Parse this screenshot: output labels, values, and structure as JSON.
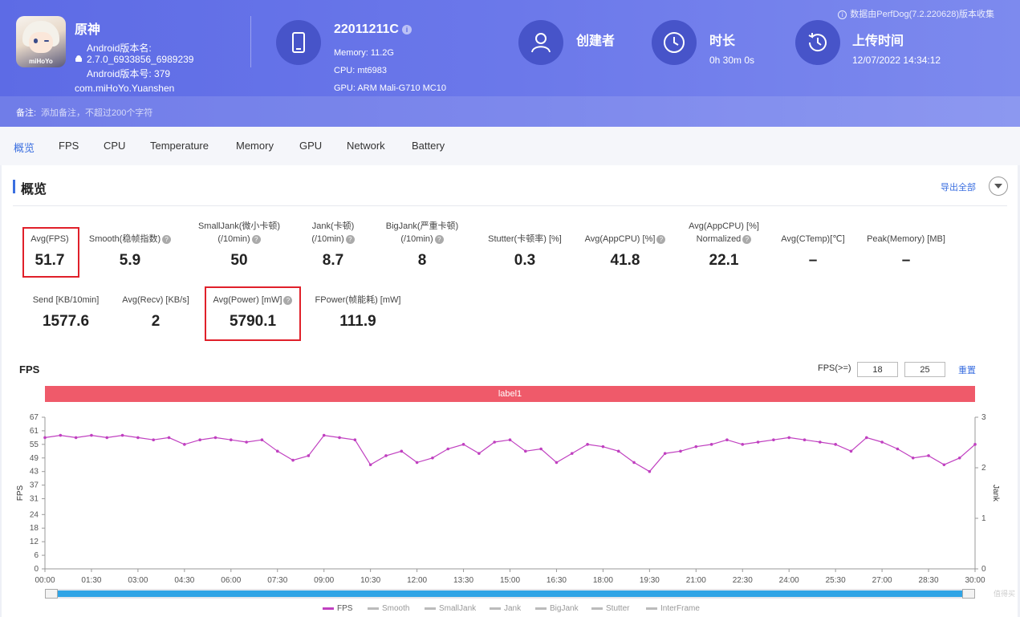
{
  "app": {
    "name": "原神",
    "icon_text": "miHoYo",
    "android_name_label": "Android版本名:",
    "android_name_value": "2.7.0_6933856_6989239",
    "android_code": "Android版本号: 379",
    "package": "com.miHoYo.Yuanshen"
  },
  "device": {
    "id": "22011211C",
    "memory": "Memory: 11.2G",
    "cpu": "CPU: mt6983",
    "gpu": "GPU: ARM Mali-G710 MC10"
  },
  "creator": {
    "title": "创建者"
  },
  "duration": {
    "title": "时长",
    "value": "0h 30m 0s"
  },
  "upload": {
    "title": "上传时间",
    "value": "12/07/2022 14:34:12"
  },
  "collected_by": "数据由PerfDog(7.2.220628)版本收集",
  "note": {
    "label": "备注:",
    "placeholder": "添加备注，不超过200个字符"
  },
  "tabs": [
    "概览",
    "FPS",
    "CPU",
    "Temperature",
    "Memory",
    "GPU",
    "Network",
    "Battery"
  ],
  "section": {
    "title": "概览",
    "export": "导出全部"
  },
  "metrics_row1": [
    {
      "label1": "",
      "label2": "Avg(FPS)",
      "value": "51.7",
      "help": false
    },
    {
      "label1": "",
      "label2": "Smooth(稳帧指数)",
      "value": "5.9",
      "help": true
    },
    {
      "label1": "SmallJank(微小卡顿)",
      "label2": "(/10min)",
      "value": "50",
      "help": true
    },
    {
      "label1": "Jank(卡顿)",
      "label2": "(/10min)",
      "value": "8.7",
      "help": true
    },
    {
      "label1": "BigJank(严重卡顿)",
      "label2": "(/10min)",
      "value": "8",
      "help": true
    },
    {
      "label1": "",
      "label2": "Stutter(卡顿率) [%]",
      "value": "0.3",
      "help": false
    },
    {
      "label1": "",
      "label2": "Avg(AppCPU) [%]",
      "value": "41.8",
      "help": true
    },
    {
      "label1": "Avg(AppCPU) [%]",
      "label2": "Normalized",
      "value": "22.1",
      "help": true
    },
    {
      "label1": "",
      "label2": "Avg(CTemp)[℃]",
      "value": "–",
      "help": false
    },
    {
      "label1": "",
      "label2": "Peak(Memory) [MB]",
      "value": "–",
      "help": false
    }
  ],
  "metrics_row2": [
    {
      "label2": "Send [KB/10min]",
      "value": "1577.6",
      "help": false
    },
    {
      "label2": "Avg(Recv) [KB/s]",
      "value": "2",
      "help": false
    },
    {
      "label2": "Avg(Power) [mW]",
      "value": "5790.1",
      "help": true
    },
    {
      "label2": "FPower(帧能耗) [mW]",
      "value": "111.9",
      "help": false
    }
  ],
  "fps_chart": {
    "title": "FPS",
    "threshold_label": "FPS(>=)",
    "threshold_low": "18",
    "threshold_high": "25",
    "reset": "重置",
    "label_bar": "label1",
    "legend": [
      "FPS",
      "Smooth",
      "SmallJank",
      "Jank",
      "BigJank",
      "Stutter",
      "InterFrame"
    ],
    "legend_active": "FPS"
  },
  "chart_data": {
    "type": "line",
    "title": "FPS",
    "ylabel": "FPS",
    "y2label": "Jank",
    "ylim": [
      0,
      67
    ],
    "y2lim": [
      0,
      3
    ],
    "yticks": [
      0,
      6,
      12,
      18,
      24,
      31,
      37,
      43,
      49,
      55,
      61,
      67
    ],
    "y2ticks": [
      0,
      1,
      2,
      3
    ],
    "xlim_minutes": [
      0,
      30
    ],
    "xticks": [
      "00:00",
      "01:30",
      "03:00",
      "04:30",
      "06:00",
      "07:30",
      "09:00",
      "10:30",
      "12:00",
      "13:30",
      "15:00",
      "16:30",
      "18:00",
      "19:30",
      "21:00",
      "22:30",
      "24:00",
      "25:30",
      "27:00",
      "28:30",
      "30:00"
    ],
    "series": [
      {
        "name": "FPS",
        "color": "#c040c0",
        "x_minutes": [
          0,
          0.5,
          1,
          1.5,
          2,
          2.5,
          3,
          3.5,
          4,
          4.5,
          5,
          5.5,
          6,
          6.5,
          7,
          7.5,
          8,
          8.5,
          9,
          9.5,
          10,
          10.5,
          11,
          11.5,
          12,
          12.5,
          13,
          13.5,
          14,
          14.5,
          15,
          15.5,
          16,
          16.5,
          17,
          17.5,
          18,
          18.5,
          19,
          19.5,
          20,
          20.5,
          21,
          21.5,
          22,
          22.5,
          23,
          23.5,
          24,
          24.5,
          25,
          25.5,
          26,
          26.5,
          27,
          27.5,
          28,
          28.5,
          29,
          29.5,
          30
        ],
        "values": [
          58,
          59,
          58,
          59,
          58,
          59,
          58,
          57,
          58,
          55,
          57,
          58,
          57,
          56,
          57,
          52,
          48,
          50,
          59,
          58,
          57,
          46,
          50,
          52,
          47,
          49,
          53,
          55,
          51,
          56,
          57,
          52,
          53,
          47,
          51,
          55,
          54,
          52,
          47,
          43,
          51,
          52,
          54,
          55,
          57,
          55,
          56,
          57,
          58,
          57,
          56,
          55,
          52,
          58,
          56,
          53,
          49,
          50,
          46,
          49,
          55
        ]
      }
    ]
  },
  "watermark": "值得买"
}
